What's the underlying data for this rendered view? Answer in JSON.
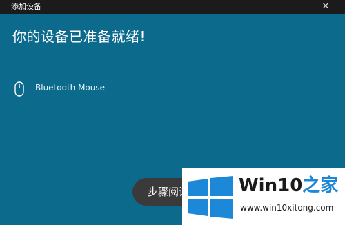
{
  "window": {
    "title": "添加设备",
    "close_glyph": "✕",
    "background_color": "#0c6a8c",
    "titlebar_color": "#1b1b1b"
  },
  "main": {
    "heading": "你的设备已准备就绪!",
    "device": {
      "icon": "mouse-icon",
      "name": "Bluetooth Mouse"
    },
    "done_button_label": "步骤阅读",
    "done_button_color": "#3a3a3a"
  },
  "watermark": {
    "logo_icon": "windows-logo-icon",
    "title_main": "Win10",
    "title_accent": "之家",
    "url": "www.win10xitong.com",
    "accent_color": "#1e88d8"
  }
}
